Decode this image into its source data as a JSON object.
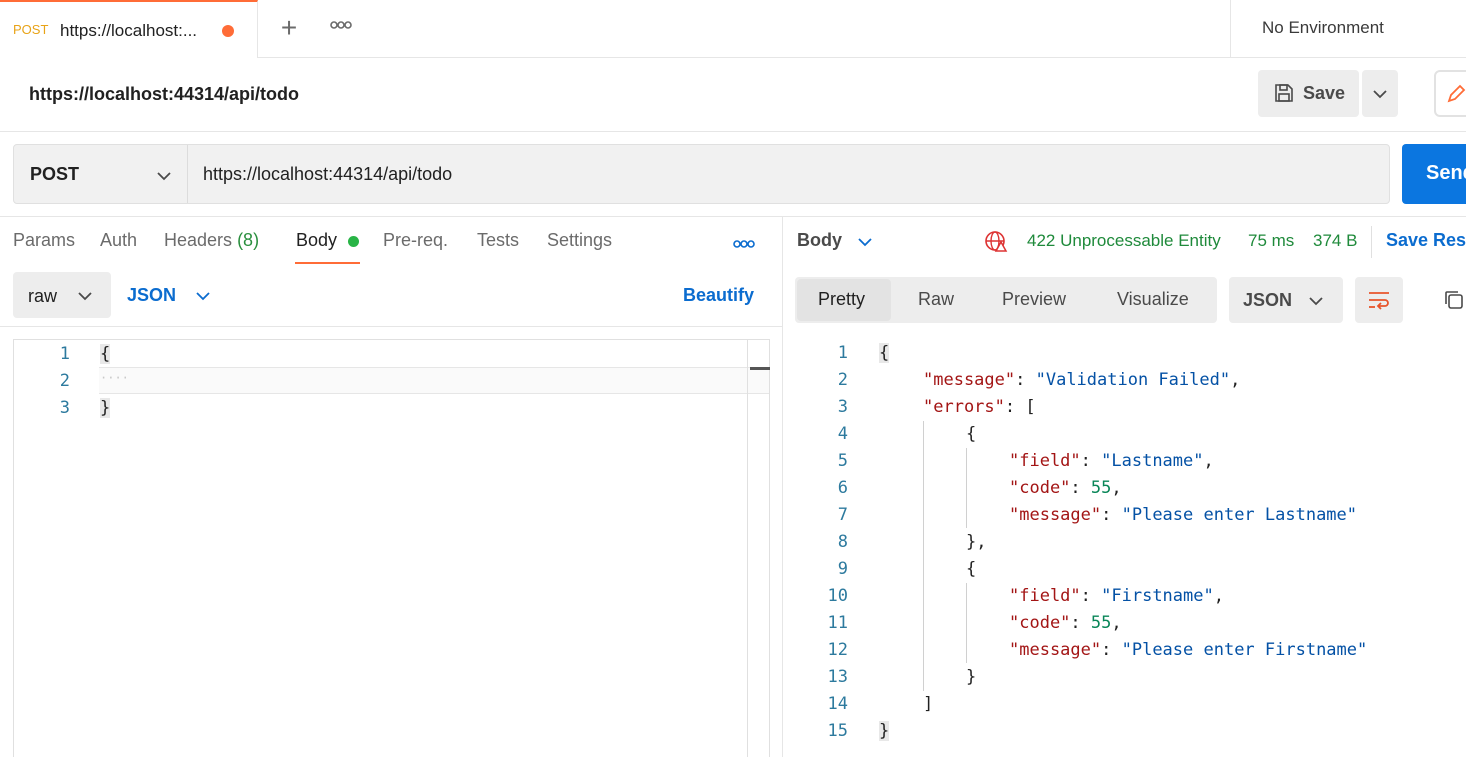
{
  "tab": {
    "method": "POST",
    "title": "https://localhost:...",
    "new_tab_icon": "plus-icon",
    "more_icon": "more-horizontal-icon"
  },
  "environment": {
    "label": "No Environment"
  },
  "request": {
    "title": "https://localhost:44314/api/todo",
    "save_label": "Save",
    "method": "POST",
    "url": "https://localhost:44314/api/todo",
    "send_label": "Send"
  },
  "request_tabs": {
    "params": "Params",
    "auth": "Auth",
    "headers": "Headers",
    "headers_count": "(8)",
    "body": "Body",
    "prereq": "Pre-req.",
    "tests": "Tests",
    "settings": "Settings"
  },
  "body_options": {
    "mode": "raw",
    "language": "JSON",
    "beautify": "Beautify"
  },
  "request_editor": {
    "line_numbers": [
      "1",
      "2",
      "3"
    ],
    "lines": [
      "{",
      "····",
      "}"
    ]
  },
  "response": {
    "section_label": "Body",
    "status": "422 Unprocessable Entity",
    "time": "75 ms",
    "size": "374 B",
    "save_response": "Save Response",
    "view_tabs": [
      "Pretty",
      "Raw",
      "Preview",
      "Visualize"
    ],
    "active_view": "Pretty",
    "format": "JSON",
    "status_color": "#1f8a3b",
    "line_numbers": [
      "1",
      "2",
      "3",
      "4",
      "5",
      "6",
      "7",
      "8",
      "9",
      "10",
      "11",
      "12",
      "13",
      "14",
      "15"
    ],
    "json": {
      "message_key": "\"message\"",
      "message_value": "\"Validation Failed\"",
      "errors_key": "\"errors\"",
      "error1_field_key": "\"field\"",
      "error1_field_value": "\"Lastname\"",
      "error1_code_key": "\"code\"",
      "error1_code_value": "55",
      "error1_message_key": "\"message\"",
      "error1_message_value": "\"Please enter Lastname\"",
      "error2_field_key": "\"field\"",
      "error2_field_value": "\"Firstname\"",
      "error2_code_key": "\"code\"",
      "error2_code_value": "55",
      "error2_message_key": "\"message\"",
      "error2_message_value": "\"Please enter Firstname\""
    }
  },
  "colors": {
    "accent": "#ff6c37",
    "send_button": "#0b76e0",
    "link_blue": "#0b6ccf",
    "json_key": "#a31515",
    "json_string": "#0451a5",
    "json_number": "#098658"
  }
}
